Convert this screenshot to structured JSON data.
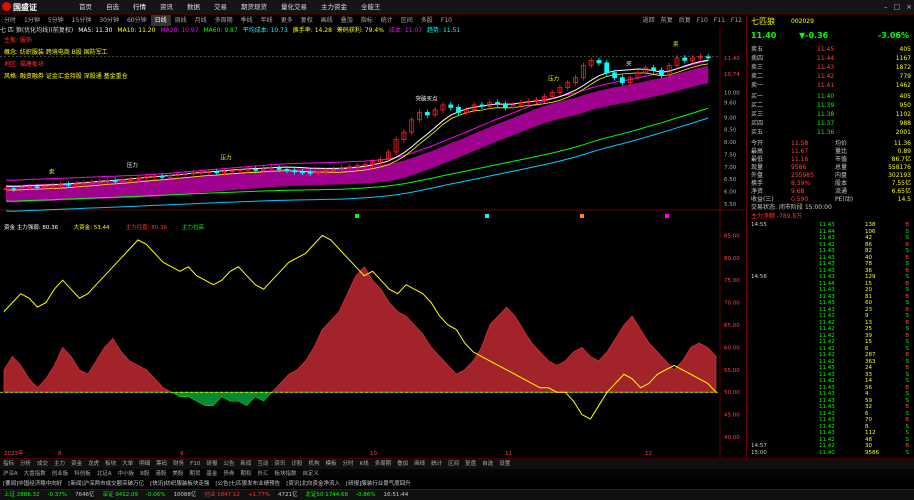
{
  "app": {
    "logo": "国盛证",
    "menu": [
      "首页",
      "自选",
      "行情",
      "资讯",
      "数据",
      "交易",
      "期货现货",
      "量化交易",
      "主力资金",
      "全能王"
    ],
    "active_menu": "行情",
    "winctl": [
      "–",
      "□",
      "×"
    ]
  },
  "periods": [
    "分时",
    "1分钟",
    "5分钟",
    "15分钟",
    "30分钟",
    "60分钟",
    "日线",
    "周线",
    "月线",
    "多周期",
    "季线",
    "年线",
    "更多",
    "复权",
    "画线",
    "叠加",
    "指标",
    "统计",
    "区间",
    "多股",
    "F10"
  ],
  "active_period": "日线",
  "toolbar_right": [
    "返回",
    "前复",
    "后复",
    "F10",
    "F11",
    "F12"
  ],
  "main_info": [
    {
      "text": "七 匹 狼(优化均线)(前复权)",
      "color": "#ddd"
    },
    {
      "text": "MA5: 11.30",
      "color": "#fff"
    },
    {
      "text": "MA10: 11.20",
      "color": "#ff0"
    },
    {
      "text": "MA20: 10.97",
      "color": "#f0f"
    },
    {
      "text": "MA60: 9.87",
      "color": "#0f0"
    },
    {
      "text": "平均成本: 10.73",
      "color": "#0ff"
    },
    {
      "text": "换手率: 14.28",
      "color": "#ff0"
    },
    {
      "text": "筹码获利: 79.4%",
      "color": "#ff0"
    },
    {
      "text": "成本: 11.07",
      "color": "#f0f"
    },
    {
      "text": "趋势: 11.51",
      "color": "#0ff"
    }
  ],
  "annotations": [
    {
      "text": "主板: 服饰",
      "color": "#f33"
    },
    {
      "text": "概念: 纺织服装 跨境电商 B股 国防军工",
      "color": "#ff0"
    },
    {
      "text": "地区: 福建板块",
      "color": "#f33"
    },
    {
      "text": "风格: 融资融券 证金汇金持股 深股通 基金重仓",
      "color": "#ff0"
    }
  ],
  "chart_labels": {
    "buy": "买",
    "sell": "卖",
    "pressure": "压力",
    "support": "支撑",
    "buy_signal": "突破买点",
    "watch": "关注",
    "upper": "上方压力",
    "lower": "下方支撑"
  },
  "price_axis": [
    "11.40",
    "10.74",
    "10.00",
    "9.60",
    "9.00",
    "8.50",
    "8.00",
    "7.50",
    "7.00",
    "6.50",
    "6.00",
    "5.50"
  ],
  "osc_axis": [
    "85.00",
    "80.00",
    "75.00",
    "70.00",
    "65.00",
    "60.00",
    "55.00",
    "50.00",
    "45.00",
    "40.00"
  ],
  "osc_info": [
    {
      "text": "资金 主力强弱: 80.36",
      "color": "#fff"
    },
    {
      "text": "大资金: 53.44",
      "color": "#ff0"
    },
    {
      "text": "主力控盘: 80.36",
      "color": "#f33"
    },
    {
      "text": "主力拉高",
      "color": "#0f0"
    }
  ],
  "dates": [
    "2023年",
    "8",
    "9",
    "10",
    "11",
    "12"
  ],
  "chart_data": {
    "type": "line",
    "candle_close": [
      6.12,
      6.1,
      6.15,
      6.2,
      6.18,
      6.22,
      6.25,
      6.3,
      6.28,
      6.32,
      6.35,
      6.38,
      6.4,
      6.45,
      6.42,
      6.48,
      6.5,
      6.55,
      6.6,
      6.62,
      6.58,
      6.65,
      6.7,
      6.72,
      6.75,
      6.78,
      6.8,
      6.76,
      6.82,
      6.85,
      6.88,
      6.9,
      6.86,
      6.92,
      6.95,
      6.9,
      6.85,
      6.8,
      6.78,
      6.75,
      6.8,
      6.85,
      6.9,
      6.95,
      7.0,
      7.05,
      7.1,
      7.2,
      7.3,
      7.6,
      8.1,
      8.4,
      8.9,
      9.2,
      9.1,
      9.3,
      9.5,
      9.4,
      9.2,
      9.3,
      9.5,
      9.45,
      9.6,
      9.55,
      9.4,
      9.5,
      9.6,
      9.65,
      9.7,
      9.85,
      10.0,
      10.2,
      10.4,
      10.6,
      11.1,
      11.3,
      11.2,
      10.8,
      10.6,
      10.4,
      10.6,
      10.8,
      11.0,
      10.9,
      10.7,
      11.1,
      11.4,
      11.3,
      11.4,
      11.45,
      11.4
    ],
    "osc_red": [
      55,
      58,
      56,
      53,
      51,
      53,
      56,
      60,
      58,
      55,
      54,
      57,
      60,
      62,
      59,
      57,
      56,
      55,
      53,
      51,
      50,
      49,
      49,
      48,
      47,
      47,
      49,
      48,
      48,
      47,
      49,
      48,
      50,
      52,
      54,
      55,
      57,
      60,
      64,
      66,
      68,
      72,
      76,
      78,
      75,
      73,
      70,
      68,
      67,
      65,
      63,
      60,
      58,
      56,
      54,
      55,
      57,
      60,
      65,
      67,
      69,
      67,
      64,
      61,
      59,
      57,
      56,
      57,
      59,
      60,
      58,
      57,
      59,
      62,
      65,
      67,
      64,
      61,
      59,
      57,
      55,
      57,
      60,
      61,
      60,
      58
    ],
    "osc_yellow": [
      68,
      70,
      72,
      71,
      69,
      70,
      73,
      75,
      73,
      71,
      72,
      74,
      76,
      78,
      80,
      82,
      84,
      83,
      81,
      79,
      78,
      77,
      78,
      76,
      75,
      74,
      75,
      77,
      78,
      76,
      74,
      73,
      75,
      77,
      79,
      80,
      81,
      83,
      85,
      84,
      82,
      80,
      78,
      76,
      77,
      75,
      73,
      72,
      74,
      73,
      72,
      70,
      67,
      65,
      64,
      61,
      59,
      58,
      57,
      56,
      55,
      54,
      53,
      52,
      51,
      51,
      50,
      50,
      48,
      45,
      44,
      47,
      50,
      52,
      54,
      53,
      51,
      52,
      54,
      55,
      56,
      55,
      54,
      53,
      52,
      50
    ]
  },
  "ticker": {
    "name": "七匹狼",
    "code": "002029",
    "price": "11.40",
    "change": "▼-0.36",
    "pct": "-3.06%"
  },
  "sell_orders": [
    {
      "label": "卖五",
      "price": "11.45",
      "vol": "405"
    },
    {
      "label": "卖四",
      "price": "11.44",
      "vol": "1167"
    },
    {
      "label": "卖三",
      "price": "11.43",
      "vol": "1872"
    },
    {
      "label": "卖二",
      "price": "11.42",
      "vol": "779"
    },
    {
      "label": "卖一",
      "price": "11.41",
      "vol": "1462"
    }
  ],
  "buy_orders": [
    {
      "label": "买一",
      "price": "11.40",
      "vol": "405"
    },
    {
      "label": "买二",
      "price": "11.39",
      "vol": "950"
    },
    {
      "label": "买三",
      "price": "11.38",
      "vol": "1102"
    },
    {
      "label": "买四",
      "price": "11.37",
      "vol": "988"
    },
    {
      "label": "买五",
      "price": "11.36",
      "vol": "2001"
    }
  ],
  "stats": [
    {
      "k": "今开",
      "v": "11.58",
      "k2": "均价",
      "v2": "11.36"
    },
    {
      "k": "最高",
      "v": "11.67",
      "k2": "量比",
      "v2": "0.89"
    },
    {
      "k": "最低",
      "v": "11.16",
      "k2": "市值",
      "v2": "86.7亿"
    },
    {
      "k": "现量",
      "v": "9586",
      "k2": "总量",
      "v2": "558176"
    },
    {
      "k": "外盘",
      "v": "255985",
      "k2": "内盘",
      "v2": "302193"
    },
    {
      "k": "换手",
      "v": "8.39%",
      "k2": "股本",
      "v2": "7.55亿"
    },
    {
      "k": "净资",
      "v": "9.68",
      "k2": "流通",
      "v2": "6.65亿"
    },
    {
      "k": "收益(三)",
      "v": "0.590",
      "k2": "PE(动)",
      "v2": "14.5"
    }
  ],
  "trade_status": "交易状态: 闭市阶段 15:00:00",
  "main_net": "主力净额 -789.8万",
  "ticks": [
    {
      "t": "14:55",
      "p": "11.43",
      "v": "138",
      "c": "B"
    },
    {
      "t": "",
      "p": "11.44",
      "v": "106",
      "c": "S"
    },
    {
      "t": "",
      "p": "11.43",
      "v": "42",
      "c": "S"
    },
    {
      "t": "",
      "p": "11.42",
      "v": "86",
      "c": "B"
    },
    {
      "t": "",
      "p": "11.43",
      "v": "82",
      "c": "S"
    },
    {
      "t": "",
      "p": "11.43",
      "v": "40",
      "c": "B"
    },
    {
      "t": "",
      "p": "11.43",
      "v": "78",
      "c": "S"
    },
    {
      "t": "",
      "p": "11.43",
      "v": "36",
      "c": "B"
    },
    {
      "t": "14:56",
      "p": "11.43",
      "v": "129",
      "c": "S"
    },
    {
      "t": "",
      "p": "11.44",
      "v": "15",
      "c": "B"
    },
    {
      "t": "",
      "p": "11.43",
      "v": "20",
      "c": "S"
    },
    {
      "t": "",
      "p": "11.43",
      "v": "81",
      "c": "B"
    },
    {
      "t": "",
      "p": "11.43",
      "v": "60",
      "c": "S"
    },
    {
      "t": "",
      "p": "11.43",
      "v": "23",
      "c": "B"
    },
    {
      "t": "",
      "p": "11.42",
      "v": "9",
      "c": "S"
    },
    {
      "t": "",
      "p": "11.42",
      "v": "13",
      "c": "B"
    },
    {
      "t": "",
      "p": "11.42",
      "v": "25",
      "c": "S"
    },
    {
      "t": "",
      "p": "11.42",
      "v": "39",
      "c": "B"
    },
    {
      "t": "",
      "p": "11.42",
      "v": "15",
      "c": "S"
    },
    {
      "t": "",
      "p": "11.42",
      "v": "6",
      "c": "S"
    },
    {
      "t": "",
      "p": "11.42",
      "v": "287",
      "c": "B"
    },
    {
      "t": "",
      "p": "11.42",
      "v": "363",
      "c": "S"
    },
    {
      "t": "",
      "p": "11.43",
      "v": "24",
      "c": "B"
    },
    {
      "t": "",
      "p": "11.43",
      "v": "33",
      "c": "S"
    },
    {
      "t": "",
      "p": "11.42",
      "v": "14",
      "c": "S"
    },
    {
      "t": "",
      "p": "11.43",
      "v": "56",
      "c": "B"
    },
    {
      "t": "",
      "p": "11.43",
      "v": "4",
      "c": "S"
    },
    {
      "t": "",
      "p": "11.43",
      "v": "59",
      "c": "S"
    },
    {
      "t": "",
      "p": "11.43",
      "v": "32",
      "c": "B"
    },
    {
      "t": "",
      "p": "11.43",
      "v": "6",
      "c": "S"
    },
    {
      "t": "",
      "p": "11.43",
      "v": "70",
      "c": "B"
    },
    {
      "t": "",
      "p": "11.42",
      "v": "8",
      "c": "S"
    },
    {
      "t": "",
      "p": "11.43",
      "v": "112",
      "c": "S"
    },
    {
      "t": "",
      "p": "11.42",
      "v": "48",
      "c": "S"
    },
    {
      "t": "14:57",
      "p": "11.42",
      "v": "30",
      "c": "B"
    },
    {
      "t": "15:00",
      "p": "11.40",
      "v": "9586",
      "c": "S"
    }
  ],
  "bottom_tabs1": [
    "指标",
    "分析",
    "成交",
    "主力",
    "资金",
    "龙虎",
    "板块",
    "大单",
    "明细",
    "筹码",
    "财务",
    "F10",
    "研报",
    "公告",
    "新闻",
    "互动",
    "资讯",
    "诊股",
    "机构",
    "模板",
    "分时",
    "K线",
    "多周期",
    "叠加",
    "画线",
    "统计",
    "区间",
    "复盘",
    "自选",
    "设置"
  ],
  "bottom_tabs2": [
    "沪深A",
    "大盘指数",
    "创业板",
    "科创板",
    "北证A",
    "中小板",
    "B股",
    "港股",
    "美股",
    "期货",
    "基金",
    "债券",
    "期权",
    "外汇",
    "板块指数",
    "自定义"
  ],
  "bottom_news": [
    "[要闻]中国经济稳中向好",
    "[新闻]沪深两市成交额突破万亿",
    "[快讯]纺织服装板块走强",
    "[公告]七匹狼发布业绩预告",
    "[资讯]北向资金净流入",
    "[研报]服装行业景气度回升"
  ],
  "statusbar": [
    {
      "text": "上证 2886.32",
      "color": "#0f0"
    },
    {
      "text": "-0.37%",
      "color": "#0f0"
    },
    {
      "text": "7646亿",
      "color": "#ccc"
    },
    {
      "text": "深证 9412.09",
      "color": "#0f0"
    },
    {
      "text": "-0.06%",
      "color": "#0f0"
    },
    {
      "text": "10088亿",
      "color": "#ccc"
    },
    {
      "text": "创业 1847.12",
      "color": "#f33"
    },
    {
      "text": "+1.77%",
      "color": "#f33"
    },
    {
      "text": "4721亿",
      "color": "#ccc"
    },
    {
      "text": "北证50 1744.68",
      "color": "#0f0"
    },
    {
      "text": "-0.86%",
      "color": "#0f0"
    },
    {
      "text": "16:51:44",
      "color": "#ccc"
    }
  ]
}
